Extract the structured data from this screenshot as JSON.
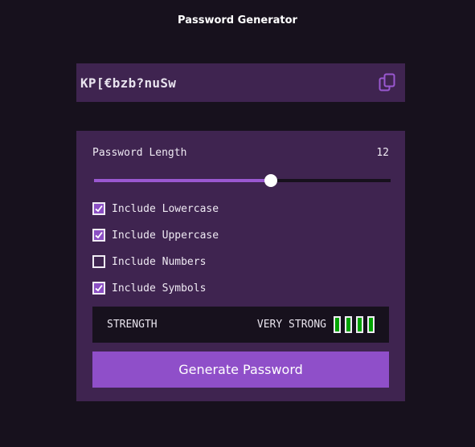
{
  "app": {
    "title": "Password Generator"
  },
  "password": {
    "value": "KP[€bzb?nuSw",
    "copy_icon": "copy-icon"
  },
  "length": {
    "label": "Password Length",
    "value": "12",
    "fraction": 0.595
  },
  "options": [
    {
      "label": "Include Lowercase",
      "checked": true
    },
    {
      "label": "Include Uppercase",
      "checked": true
    },
    {
      "label": "Include Numbers",
      "checked": false
    },
    {
      "label": "Include Symbols",
      "checked": true
    }
  ],
  "strength": {
    "label": "STRENGTH",
    "value": "VERY STRONG",
    "level": 4,
    "max": 4,
    "color": "#00a300"
  },
  "generate": {
    "label": "Generate Password"
  },
  "colors": {
    "accent": "#8f4fc9",
    "panel": "#3f2450",
    "background": "#17111d"
  }
}
